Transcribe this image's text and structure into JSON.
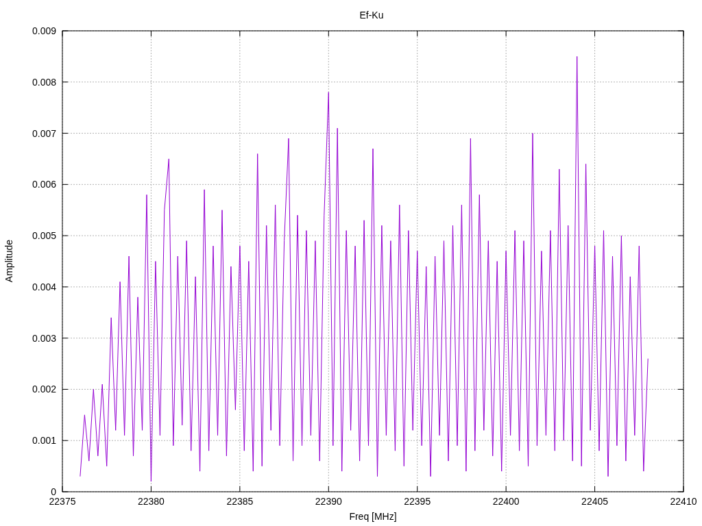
{
  "chart_data": {
    "type": "line",
    "title": "Ef-Ku",
    "xlabel": "Freq [MHz]",
    "ylabel": "Amplitude",
    "xlim": [
      22375,
      22410
    ],
    "ylim": [
      0,
      0.009
    ],
    "grid": true,
    "xticks": [
      {
        "value": 22375,
        "label": "22375"
      },
      {
        "value": 22380,
        "label": "22380"
      },
      {
        "value": 22385,
        "label": "22385"
      },
      {
        "value": 22390,
        "label": "22390"
      },
      {
        "value": 22395,
        "label": "22395"
      },
      {
        "value": 22400,
        "label": "22400"
      },
      {
        "value": 22405,
        "label": "22405"
      },
      {
        "value": 22410,
        "label": "22410"
      }
    ],
    "yticks": [
      {
        "value": 0,
        "label": "0"
      },
      {
        "value": 0.001,
        "label": "0.001"
      },
      {
        "value": 0.002,
        "label": "0.002"
      },
      {
        "value": 0.003,
        "label": "0.003"
      },
      {
        "value": 0.004,
        "label": "0.004"
      },
      {
        "value": 0.005,
        "label": "0.005"
      },
      {
        "value": 0.006,
        "label": "0.006"
      },
      {
        "value": 0.007,
        "label": "0.007"
      },
      {
        "value": 0.008,
        "label": "0.008"
      },
      {
        "value": 0.009,
        "label": "0.009"
      }
    ],
    "x": [
      22376,
      22376.25,
      22376.5,
      22376.75,
      22377,
      22377.25,
      22377.5,
      22377.75,
      22378,
      22378.25,
      22378.5,
      22378.75,
      22379,
      22379.25,
      22379.5,
      22379.75,
      22380,
      22380.25,
      22380.5,
      22380.75,
      22381,
      22381.25,
      22381.5,
      22381.75,
      22382,
      22382.25,
      22382.5,
      22382.75,
      22383,
      22383.25,
      22383.5,
      22383.75,
      22384,
      22384.25,
      22384.5,
      22384.75,
      22385,
      22385.25,
      22385.5,
      22385.75,
      22386,
      22386.25,
      22386.5,
      22386.75,
      22387,
      22387.25,
      22387.5,
      22387.75,
      22388,
      22388.25,
      22388.5,
      22388.75,
      22389,
      22389.25,
      22389.5,
      22389.75,
      22390,
      22390.25,
      22390.5,
      22390.75,
      22391,
      22391.25,
      22391.5,
      22391.75,
      22392,
      22392.25,
      22392.5,
      22392.75,
      22393,
      22393.25,
      22393.5,
      22393.75,
      22394,
      22394.25,
      22394.5,
      22394.75,
      22395,
      22395.25,
      22395.5,
      22395.75,
      22396,
      22396.25,
      22396.5,
      22396.75,
      22397,
      22397.25,
      22397.5,
      22397.75,
      22398,
      22398.25,
      22398.5,
      22398.75,
      22399,
      22399.25,
      22399.5,
      22399.75,
      22400,
      22400.25,
      22400.5,
      22400.75,
      22401,
      22401.25,
      22401.5,
      22401.75,
      22402,
      22402.25,
      22402.5,
      22402.75,
      22403,
      22403.25,
      22403.5,
      22403.75,
      22404,
      22404.25,
      22404.5,
      22404.75,
      22405,
      22405.25,
      22405.5,
      22405.75,
      22406,
      22406.25,
      22406.5,
      22406.75,
      22407,
      22407.25,
      22407.5,
      22407.75,
      22408
    ],
    "series": [
      {
        "color": "#9400d3",
        "values": [
          0.0003,
          0.0015,
          0.0006,
          0.002,
          0.0007,
          0.0021,
          0.0005,
          0.0034,
          0.0012,
          0.0041,
          0.0011,
          0.0046,
          0.0007,
          0.0038,
          0.0012,
          0.0058,
          0.0002,
          0.0045,
          0.0011,
          0.0055,
          0.0065,
          0.0009,
          0.0046,
          0.0013,
          0.0049,
          0.0008,
          0.0042,
          0.0004,
          0.0059,
          0.0008,
          0.0048,
          0.0011,
          0.0055,
          0.0007,
          0.0044,
          0.0016,
          0.0048,
          0.0008,
          0.0045,
          0.0004,
          0.0066,
          0.0005,
          0.0052,
          0.0012,
          0.0056,
          0.0009,
          0.0049,
          0.0069,
          0.0006,
          0.0054,
          0.0009,
          0.0051,
          0.0011,
          0.0049,
          0.0006,
          0.0054,
          0.0078,
          0.0009,
          0.0071,
          0.0004,
          0.0051,
          0.0012,
          0.0048,
          0.0006,
          0.0053,
          0.0009,
          0.0067,
          0.0003,
          0.0052,
          0.0011,
          0.0049,
          0.0008,
          0.0056,
          0.0005,
          0.0051,
          0.0012,
          0.0047,
          0.0009,
          0.0044,
          0.0003,
          0.0046,
          0.0011,
          0.0049,
          0.0006,
          0.0052,
          0.0009,
          0.0056,
          0.0004,
          0.0069,
          0.0008,
          0.0058,
          0.0012,
          0.0049,
          0.0007,
          0.0045,
          0.0004,
          0.0047,
          0.0011,
          0.0051,
          0.0008,
          0.0049,
          0.0005,
          0.007,
          0.0009,
          0.0047,
          0.0011,
          0.0051,
          0.0008,
          0.0063,
          0.001,
          0.0052,
          0.0006,
          0.0085,
          0.0005,
          0.0064,
          0.0012,
          0.0048,
          0.0008,
          0.0051,
          0.0003,
          0.0046,
          0.0009,
          0.005,
          0.0006,
          0.0042,
          0.0011,
          0.0048,
          0.0004,
          0.0026
        ]
      }
    ]
  }
}
